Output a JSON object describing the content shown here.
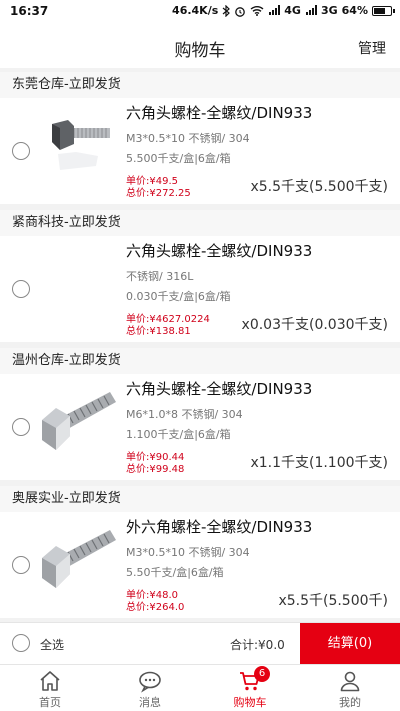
{
  "status_bar": {
    "time": "16:37",
    "net_speed": "46.4K/s",
    "network1": "4G",
    "network2": "3G",
    "battery": "64%"
  },
  "header": {
    "title": "购物车",
    "manage": "管理"
  },
  "items": [
    {
      "shop": "东莞仓库-立即发货",
      "name": "六角头螺栓-全螺纹/DIN933",
      "spec": "M3*0.5*10 不锈钢/ 304",
      "pack": "5.500千支/盒|6盒/箱",
      "unit_price": "单价:¥49.5",
      "total_price": "总价:¥272.25",
      "qty": "x5.5千支(5.500千支)",
      "image": "short-bolt"
    },
    {
      "shop": "紧商科技-立即发货",
      "name": "六角头螺栓-全螺纹/DIN933",
      "spec": " 不锈钢/ 316L",
      "pack": "0.030千支/盒|6盒/箱",
      "unit_price": "单价:¥4627.0224",
      "total_price": "总价:¥138.81",
      "qty": "x0.03千支(0.030千支)",
      "image": "none"
    },
    {
      "shop": "温州仓库-立即发货",
      "name": "六角头螺栓-全螺纹/DIN933",
      "spec": "M6*1.0*8 不锈钢/ 304",
      "pack": "1.100千支/盒|6盒/箱",
      "unit_price": "单价:¥90.44",
      "total_price": "总价:¥99.48",
      "qty": "x1.1千支(1.100千支)",
      "image": "long-bolt"
    },
    {
      "shop": "奥展实业-立即发货",
      "name": "外六角螺栓-全螺纹/DIN933",
      "spec": "M3*0.5*10 不锈钢/ 304",
      "pack": "5.50千支/盒|6盒/箱",
      "unit_price": "单价:¥48.0",
      "total_price": "总价:¥264.0",
      "qty": "x5.5千(5.500千)",
      "image": "long-bolt"
    }
  ],
  "footer": {
    "select_all": "全选",
    "sum": "合计:¥0.0",
    "checkout": "结算(0)"
  },
  "tabs": [
    {
      "label": "首页",
      "icon": "home-icon"
    },
    {
      "label": "消息",
      "icon": "message-icon"
    },
    {
      "label": "购物车",
      "icon": "cart-icon",
      "badge": "6",
      "active": true
    },
    {
      "label": "我的",
      "icon": "user-icon"
    }
  ],
  "colors": {
    "accent": "#e50012",
    "price": "#d0021b"
  }
}
